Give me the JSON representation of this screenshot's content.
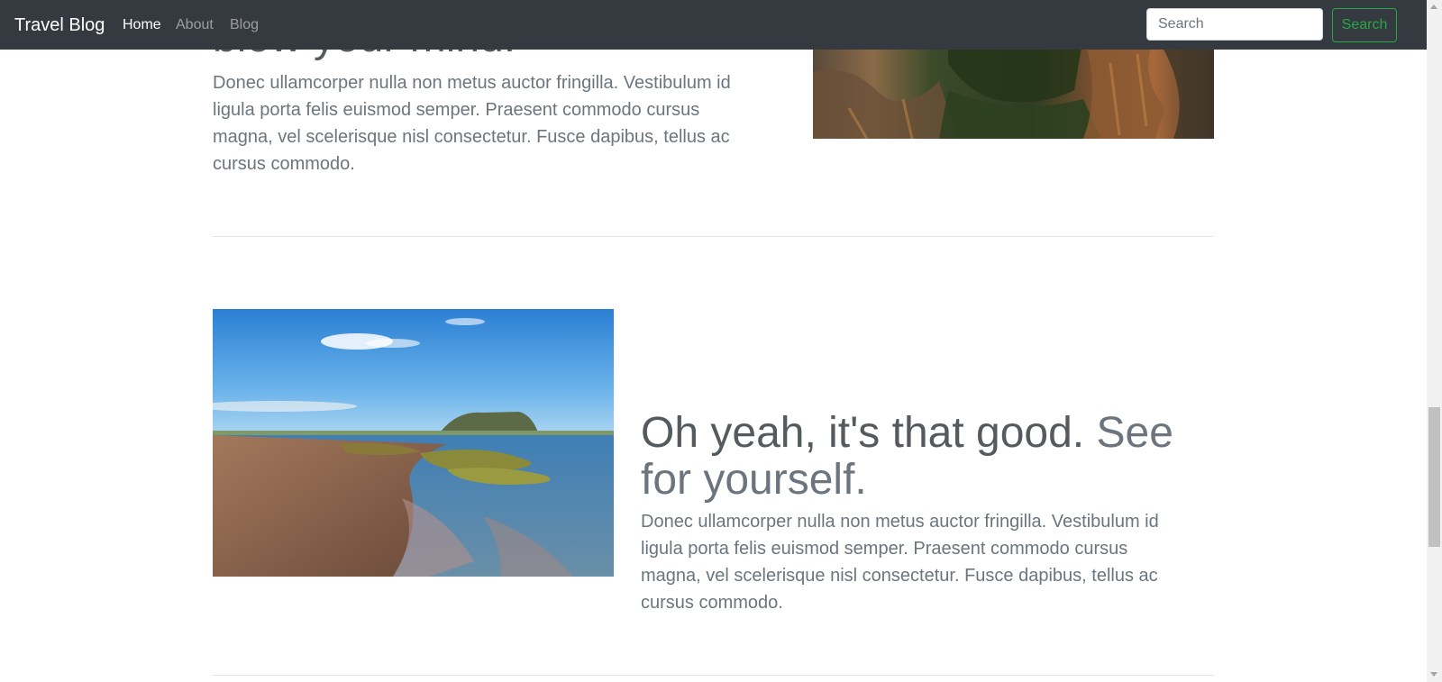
{
  "navbar": {
    "brand": "Travel Blog",
    "links": [
      {
        "label": "Home",
        "active": true
      },
      {
        "label": "About",
        "active": false
      },
      {
        "label": "Blog",
        "active": false
      }
    ],
    "search": {
      "placeholder": "Search",
      "button_label": "Search",
      "button_color": "#28a745"
    },
    "background": "#343a40"
  },
  "features": [
    {
      "heading_visible_part": "blow your mind.",
      "text": "Donec ullamcorper nulla non metus auctor fringilla. Vestibulum id ligula porta felis euismod semper. Praesent commodo cursus magna, vel scelerisque nisl consectetur. Fusce dapibus, tellus ac cursus commodo."
    },
    {
      "heading": "Oh yeah, it's that good.",
      "heading_muted": "See for yourself.",
      "text": "Donec ullamcorper nulla non metus auctor fringilla. Vestibulum id ligula porta felis euismod semper. Praesent commodo cursus magna, vel scelerisque nisl consectetur. Fusce dapibus, tellus ac cursus commodo."
    }
  ],
  "scrollbar": {
    "position_fraction": 0.62
  }
}
